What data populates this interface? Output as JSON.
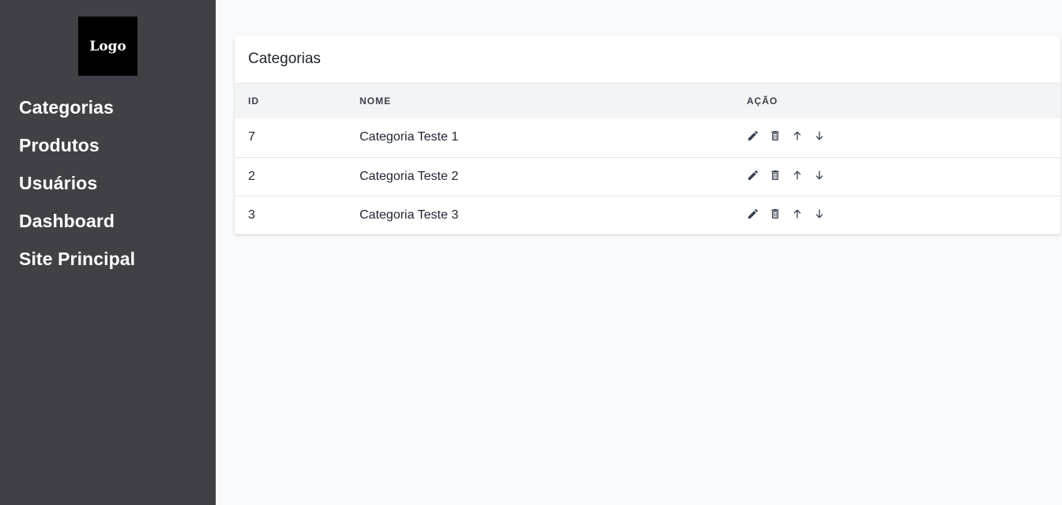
{
  "sidebar": {
    "logo": "Logo",
    "items": [
      {
        "label": "Categorias"
      },
      {
        "label": "Produtos"
      },
      {
        "label": "Usuários"
      },
      {
        "label": "Dashboard"
      },
      {
        "label": "Site Principal"
      }
    ]
  },
  "card": {
    "title": "Categorias",
    "columns": [
      "ID",
      "NOME",
      "AÇÃO"
    ],
    "rows": [
      {
        "id": "7",
        "nome": "Categoria Teste 1"
      },
      {
        "id": "2",
        "nome": "Categoria Teste 2"
      },
      {
        "id": "3",
        "nome": "Categoria Teste 3"
      }
    ],
    "action_icons": [
      "edit-icon",
      "trash-icon",
      "arrow-up-icon",
      "arrow-down-icon"
    ]
  },
  "colors": {
    "sidebar_bg": "#414046",
    "page_bg": "#f8f9fa",
    "header_bg": "#f3f4f6",
    "icon_color": "#374151"
  }
}
